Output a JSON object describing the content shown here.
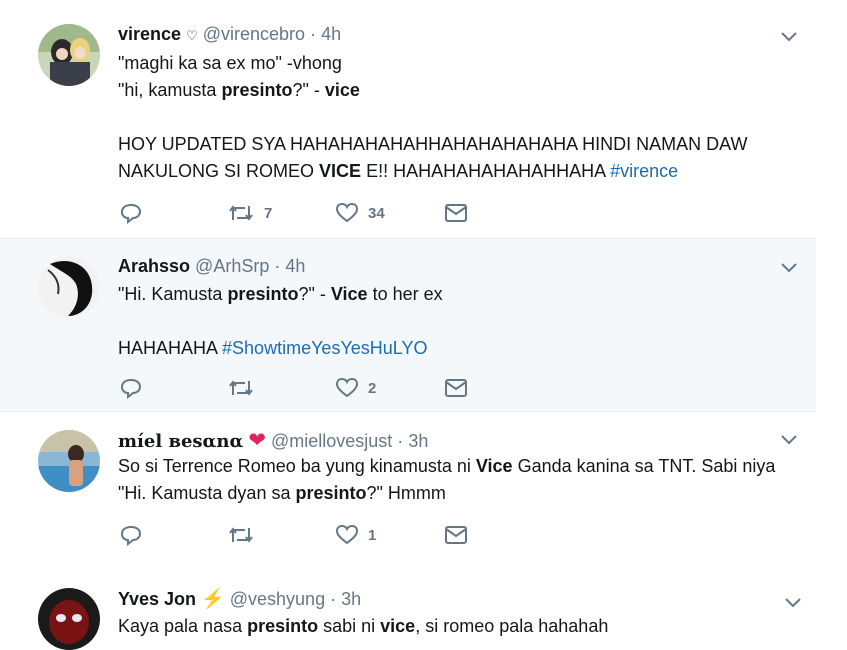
{
  "tweets": [
    {
      "name": "virence",
      "handle": "@virencebro",
      "time": "4h",
      "lines": [
        [
          "\"maghi ka sa ex mo\" -vhong"
        ],
        [
          "\"hi, kamusta ",
          "presinto",
          "?\" - ",
          "vice"
        ],
        [
          ""
        ],
        [
          "HOY UPDATED SYA HAHAHAHAHAHHAHAHAHAHAHA HINDI NAMAN DAW"
        ],
        [
          "NAKULONG SI ROMEO ",
          "VICE",
          " E!! HAHAHAHAHAHAHHAHA ",
          "#virence"
        ]
      ],
      "replies": "",
      "retweets": "7",
      "likes": "34"
    },
    {
      "name": "Arahsso",
      "handle": "@ArhSrp",
      "time": "4h",
      "line1": [
        "\"Hi. Kamusta ",
        "presinto",
        "?\" - ",
        "Vice",
        " to her ex"
      ],
      "line2": [
        "HAHAHAHA ",
        "#ShowtimeYesYesHuLYO"
      ],
      "retweets": "",
      "likes": "2"
    },
    {
      "name": "míel вesαnα",
      "handle": "@miellovesjust",
      "time": "3h",
      "line1": [
        "So si Terrence Romeo ba yung kinamusta ni ",
        "Vice",
        " Ganda kanina sa TNT. Sabi niya"
      ],
      "line2": [
        "\"Hi. Kamusta dyan sa ",
        "presinto",
        "?\" Hmmm"
      ],
      "retweets": "",
      "likes": "1"
    },
    {
      "name": "Yves Jon",
      "handle": "@veshyung",
      "time": "3h",
      "line1": [
        "Kaya pala nasa ",
        "presinto",
        " sabi ni ",
        "vice",
        ", si romeo pala hahahah"
      ]
    }
  ],
  "icons": {
    "reply": "reply-icon",
    "retweet": "retweet-icon",
    "like": "heart-icon",
    "dm": "envelope-icon",
    "more": "chevron-down-icon",
    "heart_emoji": "red-heart-icon",
    "lightning_emoji": "lightning-icon"
  },
  "colors": {
    "hashtag": "#1b6cb0",
    "muted": "#657786",
    "heart": "#e0245e",
    "bolt": "#f4a623"
  }
}
